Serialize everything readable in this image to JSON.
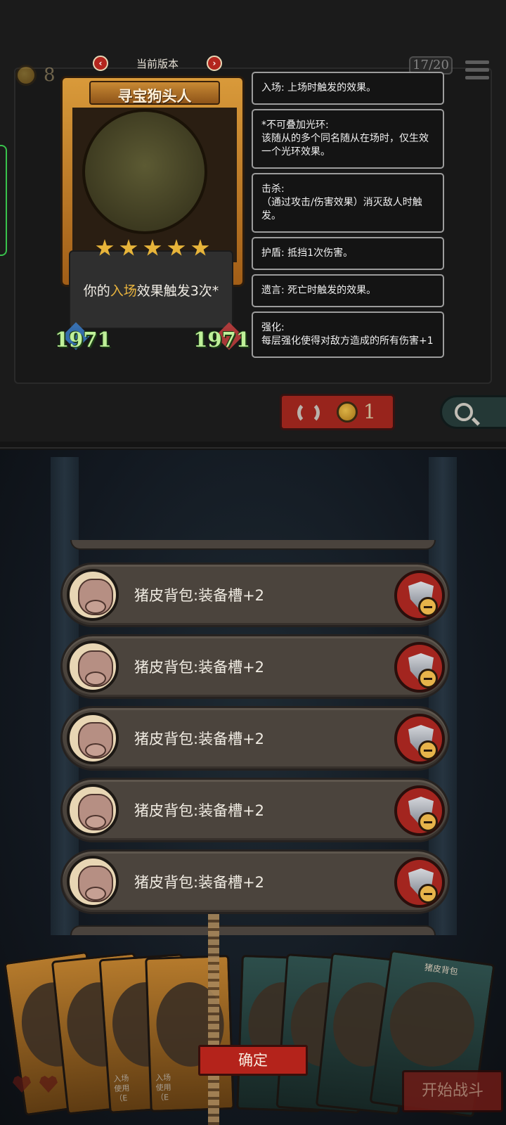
{
  "hud": {
    "coins": "8",
    "turn": "17/20"
  },
  "version": {
    "label": "当前版本"
  },
  "hero_card": {
    "name": "寻宝狗头人",
    "desc_prefix": "你的",
    "desc_highlight": "入场",
    "desc_suffix": "效果触发3次*",
    "attack": "1971",
    "health": "1971",
    "stars": 5
  },
  "keywords": [
    "入场: 上场时触发的效果。",
    "*不可叠加光环:\n该随从的多个同名随从在场时，仅生效一个光环效果。",
    "击杀:\n（通过攻击/伤害效果）消灭敌人时触发。",
    "护盾: 抵挡1次伤害。",
    "遗言: 死亡时触发的效果。",
    "强化:\n每层强化使得对敌方造成的所有伤害+1"
  ],
  "shop": {
    "refresh_cost": "1"
  },
  "equipment": [
    {
      "label": "猪皮背包:装备槽+2"
    },
    {
      "label": "猪皮背包:装备槽+2"
    },
    {
      "label": "猪皮背包:装备槽+2"
    },
    {
      "label": "猪皮背包:装备槽+2"
    },
    {
      "label": "猪皮背包:装备槽+2"
    }
  ],
  "hand": {
    "top_card_label": "猪皮背包",
    "card_texts": [
      "入场\n使用\n（E",
      "入场\n使用\n（E"
    ]
  },
  "buttons": {
    "confirm": "确定",
    "start_battle": "开始战斗"
  },
  "colors": {
    "accent_red": "#b4231b",
    "highlight_gold": "#e8b33e",
    "stat_green": "#bff099"
  }
}
